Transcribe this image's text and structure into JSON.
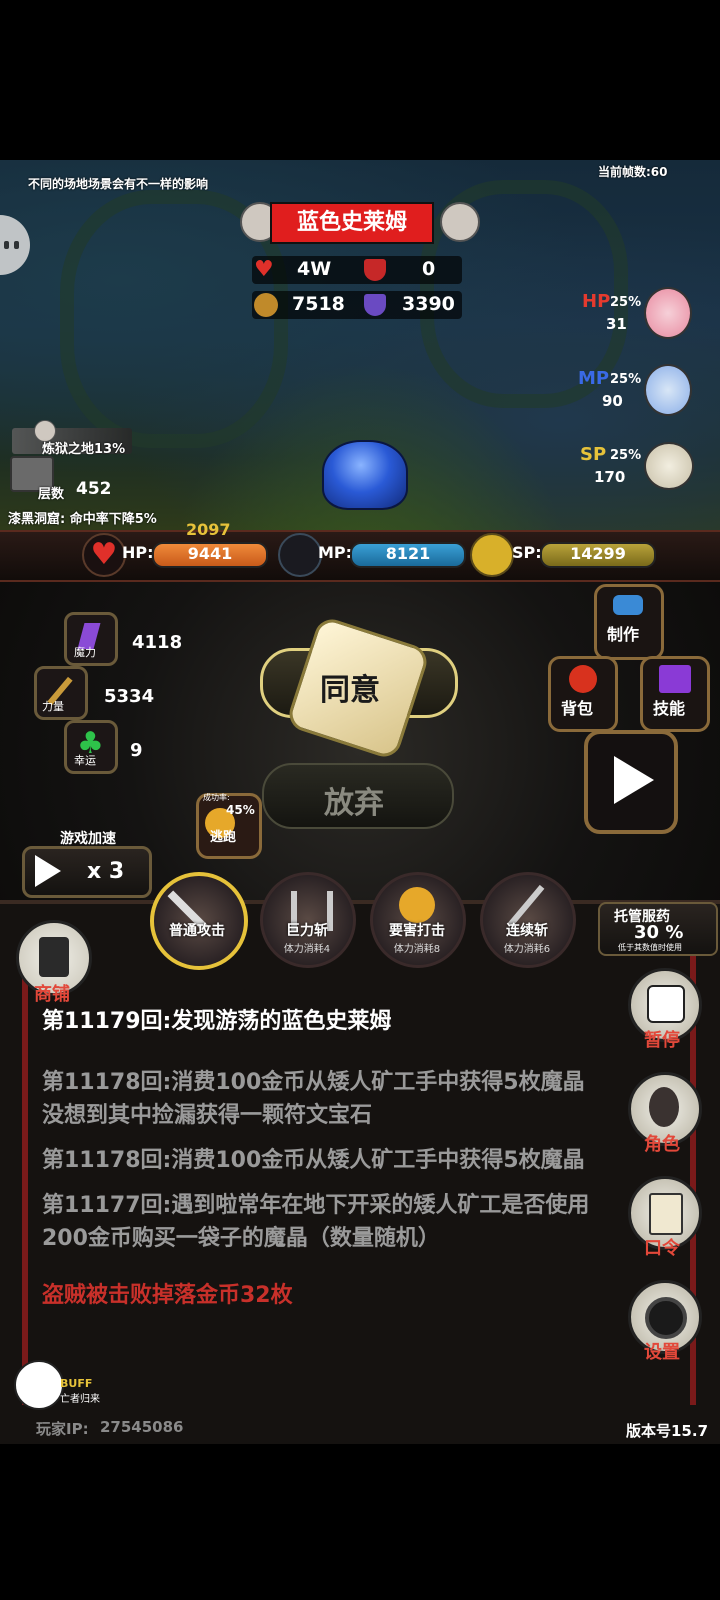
{
  "scene": {
    "hint": "不同的场地场景会有不一样的影响",
    "fps": "当前帧数:60",
    "enemy_name": "蓝色史莱姆",
    "enemy_stats": {
      "hp": "4W",
      "armor": "0",
      "attack": "7518",
      "defense": "3390"
    },
    "potions": [
      {
        "label": "HP",
        "percent": "25%",
        "count": "31",
        "color": "#e53a2e"
      },
      {
        "label": "MP",
        "percent": "25%",
        "count": "90",
        "color": "#3a6ae6"
      },
      {
        "label": "SP",
        "percent": "25%",
        "count": "170",
        "color": "#e6c23a"
      }
    ],
    "area": "炼狱之地13%",
    "floor_label": "层数",
    "floor_value": "452",
    "area_effect": "漆黑洞窟: 命中率下降5%"
  },
  "player": {
    "hp_gain": "2097",
    "hp_label": "HP:",
    "hp_value": "9441",
    "mp_label": "MP:",
    "mp_value": "8121",
    "sp_label": "SP:",
    "sp_value": "14299",
    "attrs": [
      {
        "name": "魔力",
        "value": "4118",
        "color": "#8a4ad6"
      },
      {
        "name": "力量",
        "value": "5334",
        "color": "#c99a3a"
      },
      {
        "name": "幸运",
        "value": "9",
        "color": "#2ec24a"
      }
    ]
  },
  "actions": {
    "agree": "同意",
    "abandon": "放弃",
    "escape_label": "成功率:",
    "escape_rate": "45%",
    "escape": "逃跑",
    "speed_title": "游戏加速",
    "speed_value": "x 3",
    "craft": "制作",
    "bag": "背包",
    "skills": "技能"
  },
  "skills": [
    {
      "name": "普通攻击",
      "cost": ""
    },
    {
      "name": "巨力斩",
      "cost": "体力消耗4"
    },
    {
      "name": "要害打击",
      "cost": "体力消耗8"
    },
    {
      "name": "连续斩",
      "cost": "体力消耗6"
    }
  ],
  "auto_potion": {
    "title": "托管服药",
    "value": "30 %",
    "note": "低于其数值时使用"
  },
  "shop": "商铺",
  "side_buttons": [
    "暂停",
    "角色",
    "口令",
    "设置"
  ],
  "log": [
    {
      "text": "第11179回:发现游荡的蓝色史莱姆",
      "color": "#ffffff"
    },
    {
      "text": "第11178回:消费100金币从矮人矿工手中获得5枚魔晶没想到其中捡漏获得一颗符文宝石",
      "color": "#9a9a9a"
    },
    {
      "text": "第11178回:消费100金币从矮人矿工手中获得5枚魔晶",
      "color": "#9a9a9a"
    },
    {
      "text": "第11177回:遇到啦常年在地下开采的矮人矿工是否使用200金币购买一袋子的魔晶（数量随机）",
      "color": "#9a9a9a"
    },
    {
      "text": "盗贼被击败掉落金币32枚",
      "color": "#c8302a"
    }
  ],
  "buff": {
    "label": "BUFF",
    "name": "亡者归来"
  },
  "player_ip_label": "玩家IP:",
  "player_ip": "27545086",
  "version": "版本号15.7"
}
